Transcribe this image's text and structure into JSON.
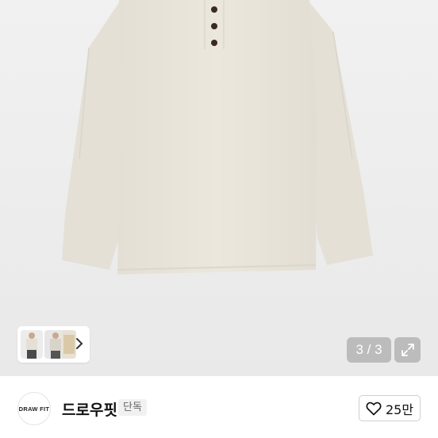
{
  "gallery": {
    "counter": "3 / 3",
    "thumbnails": [
      "model-front-thumbnail",
      "model-side-thumbnail",
      "shirt-thumbnail"
    ]
  },
  "shop": {
    "logo_text": "DRAW FIT",
    "name": "드로우핏",
    "badge": "단독"
  },
  "like": {
    "count": "25만"
  },
  "colors": {
    "shirt": "#e8e4da",
    "button": "#3a2a22",
    "counter_bg": "#969696"
  }
}
